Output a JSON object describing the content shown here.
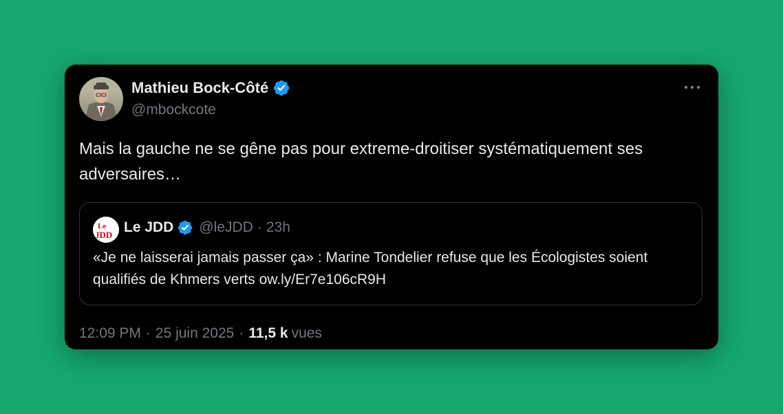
{
  "tweet": {
    "author_name": "Mathieu Bock-Côté",
    "author_handle": "@mbockcote",
    "text": "Mais la gauche ne se gêne pas pour extreme-droitiser systématiquement ses adversaires…",
    "timestamp": "12:09 PM",
    "date": "25 juin 2025",
    "views_count": "11,5 k",
    "views_label": "vues",
    "separator": "·"
  },
  "quote": {
    "name": "Le JDD",
    "handle": "@leJDD",
    "separator": "·",
    "time": "23h",
    "text": "«Je ne laisserai jamais passer ça» : Marine Tondelier refuse que les Écologistes soient qualifiés de Khmers verts ow.ly/Er7e106cR9H",
    "logo_text_top": "Le",
    "logo_text_bottom": "JDD"
  },
  "colors": {
    "background": "#16a86e",
    "card": "#000000",
    "text_primary": "#e7e9ea",
    "text_secondary": "#71767b",
    "verified": "#1d9bf0",
    "jdd_red": "#e2001a"
  },
  "icons": {
    "verified": "verified-badge-icon",
    "more": "more-horizontal-icon"
  }
}
